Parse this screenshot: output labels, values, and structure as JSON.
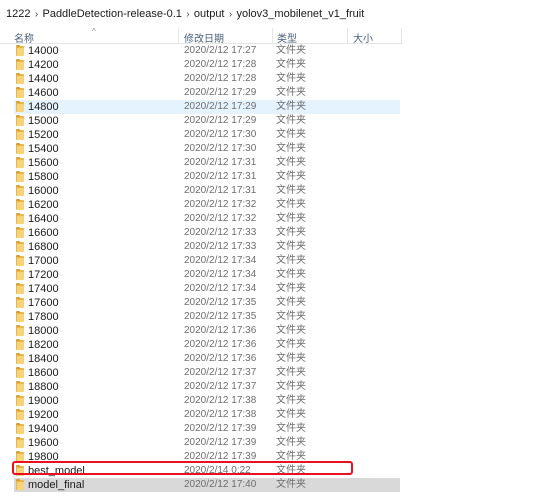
{
  "breadcrumb": [
    "1222",
    "PaddleDetection-release-0.1",
    "output",
    "yolov3_mobilenet_v1_fruit"
  ],
  "columns": {
    "name": "名称",
    "date": "修改日期",
    "type": "类型",
    "size": "大小"
  },
  "files": [
    {
      "name": "14000",
      "date": "2020/2/12 17:27",
      "type": "文件夹"
    },
    {
      "name": "14200",
      "date": "2020/2/12 17:28",
      "type": "文件夹"
    },
    {
      "name": "14400",
      "date": "2020/2/12 17:28",
      "type": "文件夹"
    },
    {
      "name": "14600",
      "date": "2020/2/12 17:29",
      "type": "文件夹"
    },
    {
      "name": "14800",
      "date": "2020/2/12 17:29",
      "type": "文件夹",
      "state": "hover"
    },
    {
      "name": "15000",
      "date": "2020/2/12 17:29",
      "type": "文件夹"
    },
    {
      "name": "15200",
      "date": "2020/2/12 17:30",
      "type": "文件夹"
    },
    {
      "name": "15400",
      "date": "2020/2/12 17:30",
      "type": "文件夹"
    },
    {
      "name": "15600",
      "date": "2020/2/12 17:31",
      "type": "文件夹"
    },
    {
      "name": "15800",
      "date": "2020/2/12 17:31",
      "type": "文件夹"
    },
    {
      "name": "16000",
      "date": "2020/2/12 17:31",
      "type": "文件夹"
    },
    {
      "name": "16200",
      "date": "2020/2/12 17:32",
      "type": "文件夹"
    },
    {
      "name": "16400",
      "date": "2020/2/12 17:32",
      "type": "文件夹"
    },
    {
      "name": "16600",
      "date": "2020/2/12 17:33",
      "type": "文件夹"
    },
    {
      "name": "16800",
      "date": "2020/2/12 17:33",
      "type": "文件夹"
    },
    {
      "name": "17000",
      "date": "2020/2/12 17:34",
      "type": "文件夹"
    },
    {
      "name": "17200",
      "date": "2020/2/12 17:34",
      "type": "文件夹"
    },
    {
      "name": "17400",
      "date": "2020/2/12 17:34",
      "type": "文件夹"
    },
    {
      "name": "17600",
      "date": "2020/2/12 17:35",
      "type": "文件夹"
    },
    {
      "name": "17800",
      "date": "2020/2/12 17:35",
      "type": "文件夹"
    },
    {
      "name": "18000",
      "date": "2020/2/12 17:36",
      "type": "文件夹"
    },
    {
      "name": "18200",
      "date": "2020/2/12 17:36",
      "type": "文件夹"
    },
    {
      "name": "18400",
      "date": "2020/2/12 17:36",
      "type": "文件夹"
    },
    {
      "name": "18600",
      "date": "2020/2/12 17:37",
      "type": "文件夹"
    },
    {
      "name": "18800",
      "date": "2020/2/12 17:37",
      "type": "文件夹"
    },
    {
      "name": "19000",
      "date": "2020/2/12 17:38",
      "type": "文件夹"
    },
    {
      "name": "19200",
      "date": "2020/2/12 17:38",
      "type": "文件夹"
    },
    {
      "name": "19400",
      "date": "2020/2/12 17:39",
      "type": "文件夹"
    },
    {
      "name": "19600",
      "date": "2020/2/12 17:39",
      "type": "文件夹"
    },
    {
      "name": "19800",
      "date": "2020/2/12 17:39",
      "type": "文件夹"
    },
    {
      "name": "best_model",
      "date": "2020/2/14 0:22",
      "type": "文件夹",
      "state": "annotated"
    },
    {
      "name": "model_final",
      "date": "2020/2/12 17:40",
      "type": "文件夹",
      "state": "selected"
    }
  ],
  "colors": {
    "hover_bg": "#e5f3ff",
    "selected_bg": "#d9d9d9",
    "annotation": "#e81123",
    "folder": "#f6d57a"
  }
}
